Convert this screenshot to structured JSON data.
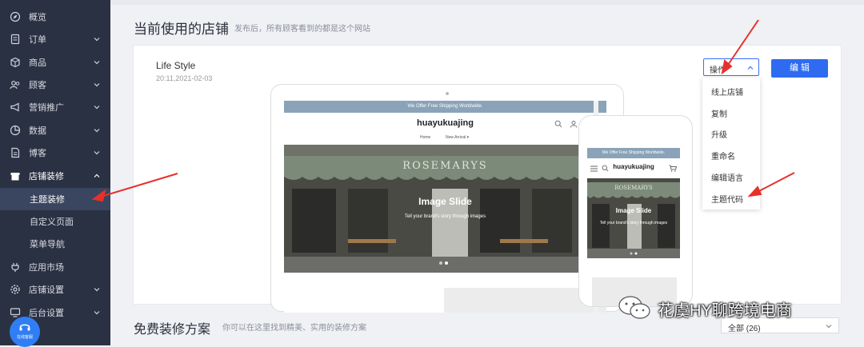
{
  "sidebar": {
    "items": [
      {
        "label": "概览",
        "icon": "compass-icon",
        "chevron": false
      },
      {
        "label": "订单",
        "icon": "order-icon",
        "chevron": true
      },
      {
        "label": "商品",
        "icon": "box-icon",
        "chevron": true
      },
      {
        "label": "顾客",
        "icon": "users-icon",
        "chevron": true
      },
      {
        "label": "营销推广",
        "icon": "megaphone-icon",
        "chevron": true
      },
      {
        "label": "数据",
        "icon": "pie-chart-icon",
        "chevron": true
      },
      {
        "label": "博客",
        "icon": "document-icon",
        "chevron": true
      },
      {
        "label": "店铺装修",
        "icon": "store-icon",
        "chevron": true,
        "expanded": true
      }
    ],
    "sub_items": [
      "主题装修",
      "自定义页面",
      "菜单导航"
    ],
    "active_sub_item": "主题装修",
    "bottom_items": [
      {
        "label": "应用市场",
        "icon": "plug-icon",
        "chevron": false
      },
      {
        "label": "店铺设置",
        "icon": "gear-icon",
        "chevron": true
      },
      {
        "label": "后台设置",
        "icon": "monitor-icon",
        "chevron": true
      }
    ],
    "support_label": "在线客服"
  },
  "header": {
    "title": "当前使用的店铺",
    "subtitle": "发布后，所有顾客看到的都是这个网站"
  },
  "theme": {
    "name": "Life Style",
    "time": "20:11,2021-02-03",
    "action_label": "操作",
    "edit_label": "编 辑",
    "dropdown": [
      "线上店铺",
      "复制",
      "升级",
      "重命名",
      "编辑语言",
      "主题代码"
    ]
  },
  "preview": {
    "banner": "We Offer Free Shipping Worldwide.",
    "brand": "huayukuajing",
    "nav_home": "Home",
    "nav_new": "New Arrival",
    "awning_text": "ROSEMARYS",
    "hero_title": "Image Slide",
    "hero_sub": "Tell your brand's story through images"
  },
  "section2": {
    "title": "免费装修方案",
    "subtitle": "你可以在这里找到精美、实用的装修方案",
    "select_value": "全部 (26)"
  },
  "watermark": {
    "text": "花虞HY聊跨境电商"
  },
  "colors": {
    "sidebar_bg": "#2a3142",
    "active_bg": "#3a4560",
    "primary": "#2f6bf0",
    "arrow": "#e8302a"
  }
}
